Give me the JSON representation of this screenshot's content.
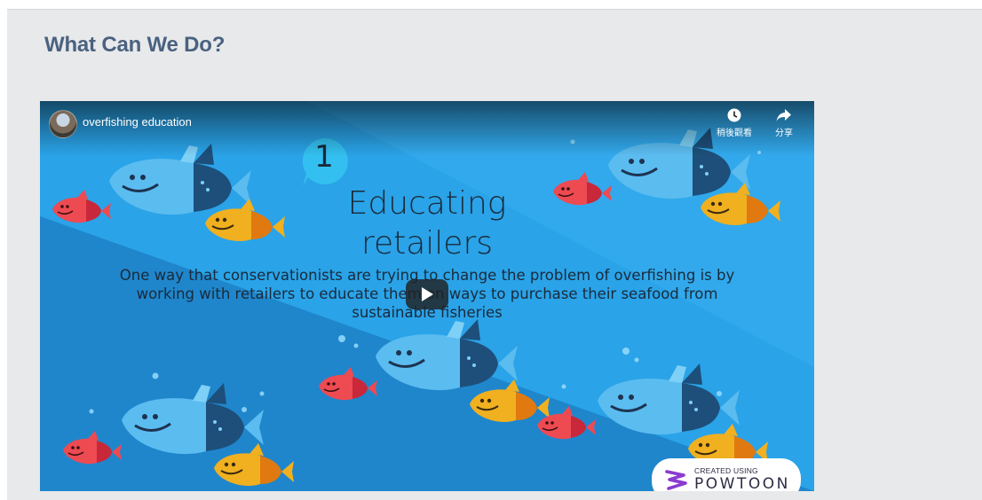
{
  "section": {
    "heading": "What Can We Do?"
  },
  "video": {
    "channel_title": "overfishing education",
    "controls": {
      "watch_later_label": "稍後觀看",
      "share_label": "分享"
    },
    "slide": {
      "number": "1",
      "title_line1": "Educating",
      "title_line2": "retailers",
      "body": "One way that conservationists are trying to change the problem of overfishing is by working with retailers to educate them on ways to purchase their seafood from sustainable fisheries"
    },
    "watermark": {
      "small_text": "CREATED USING",
      "brand_text": "POWTOON"
    }
  },
  "colors": {
    "heading": "#4a6280",
    "video_bg_light": "#2aa3e8",
    "video_bg_dark": "#1f86cc",
    "big_fish_light": "#5bbcf0",
    "big_fish_dark": "#1d4f7a",
    "yellow_fish": "#f0b020",
    "red_fish": "#ee4a52",
    "powtoon_logo": "#8a3ccf"
  }
}
